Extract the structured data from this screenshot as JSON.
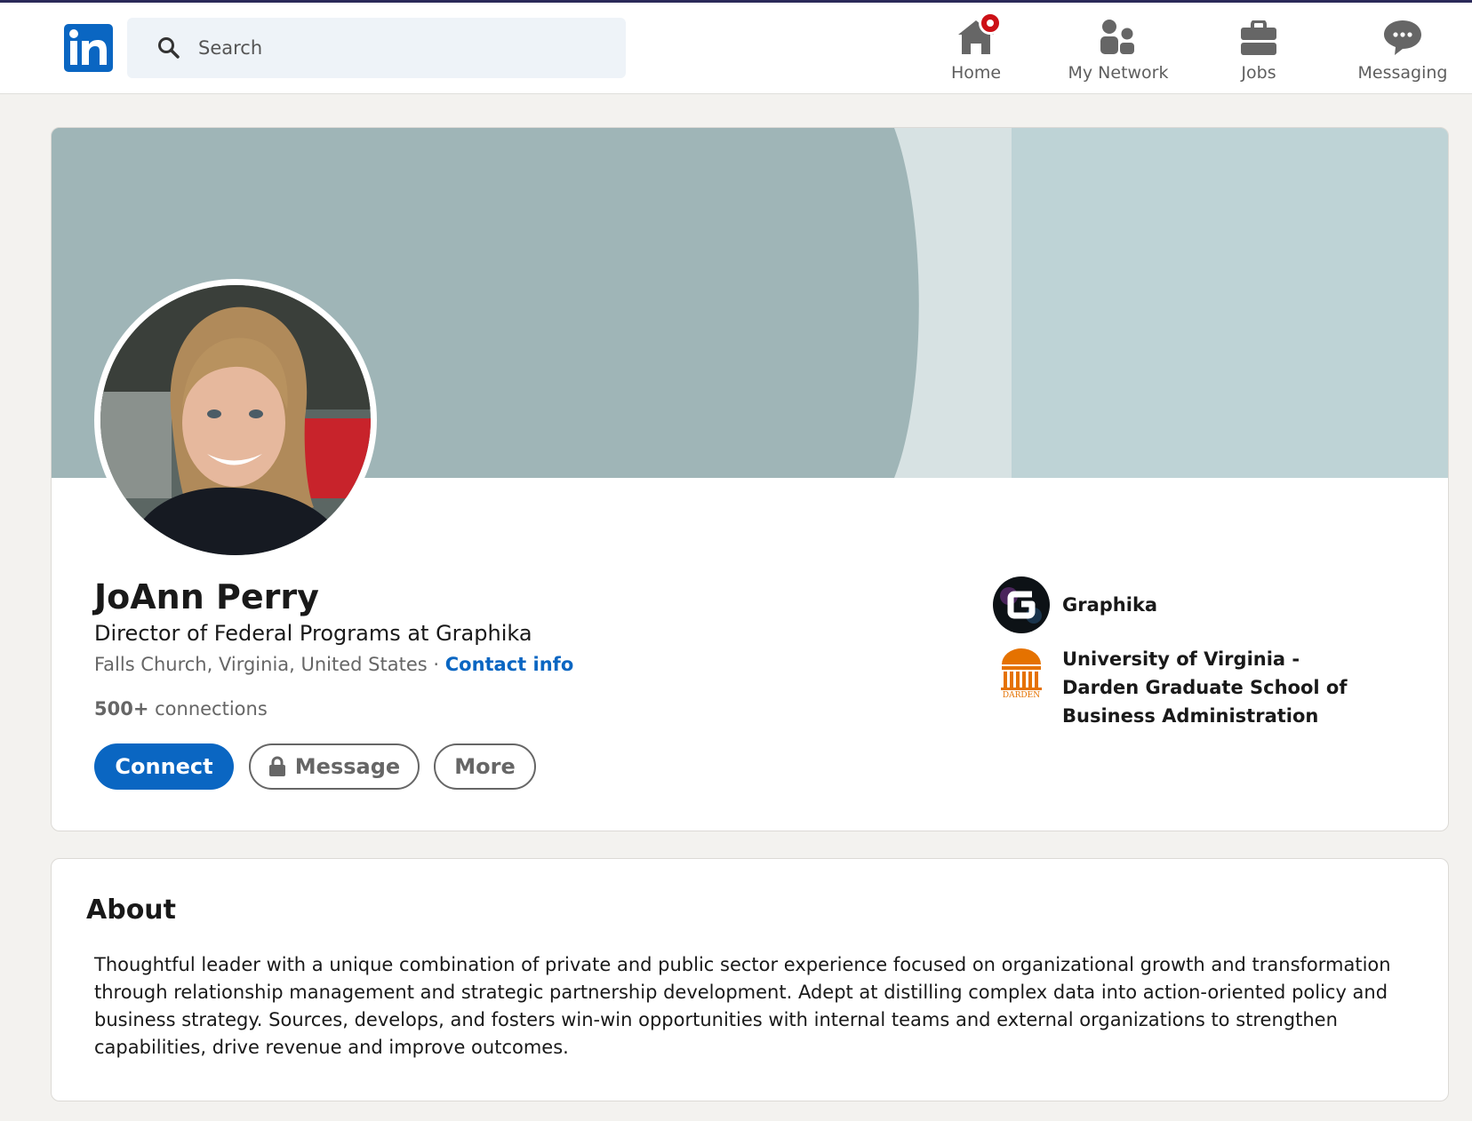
{
  "nav": {
    "search_placeholder": "Search",
    "items": [
      {
        "label": "Home",
        "icon": "home-icon"
      },
      {
        "label": "My Network",
        "icon": "people-icon"
      },
      {
        "label": "Jobs",
        "icon": "briefcase-icon"
      },
      {
        "label": "Messaging",
        "icon": "messaging-icon"
      }
    ]
  },
  "profile": {
    "name": "JoAnn Perry",
    "headline": "Director of Federal Programs at Graphika",
    "location": "Falls Church, Virginia, United States",
    "separator": " · ",
    "contact_info": "Contact info",
    "connections_count": "500+",
    "connections_label": " connections",
    "buttons": {
      "connect": "Connect",
      "message": "Message",
      "more": "More"
    },
    "experience": {
      "company": "Graphika"
    },
    "education": {
      "school": "University of Virginia - Darden Graduate School of Business Administration",
      "logo_text": "DARDEN"
    }
  },
  "about": {
    "title": "About",
    "text": "Thoughtful leader with a unique combination of private and public sector experience focused on organizational growth and transformation through relationship management and strategic partnership development. Adept at distilling complex data into action-oriented policy and business strategy. Sources, develops, and fosters win-win opportunities with internal teams and external organizations to strengthen capabilities, drive revenue and improve outcomes."
  },
  "colors": {
    "brand": "#0a66c2",
    "notification": "#cc1016",
    "banner_dark": "#9fb5b7",
    "banner_light": "#bed3d6"
  }
}
